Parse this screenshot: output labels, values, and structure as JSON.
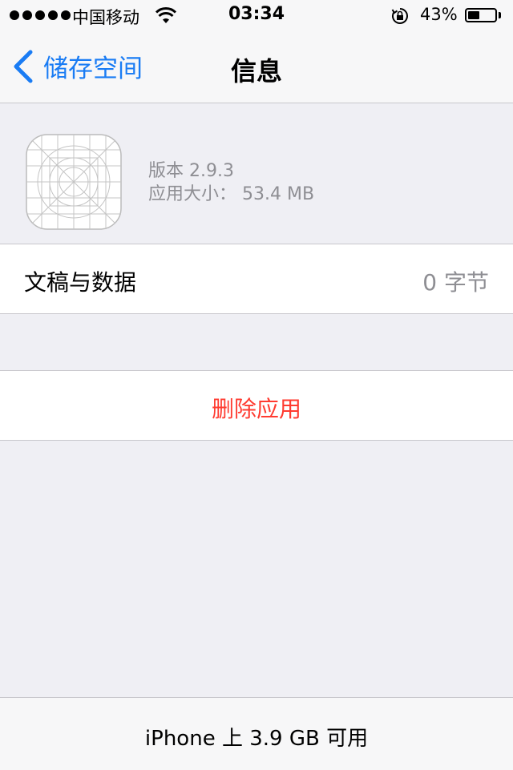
{
  "status_bar": {
    "carrier": "中国移动",
    "time": "03:34",
    "battery": "43%",
    "battery_level": 0.43,
    "icons": [
      "signal-icon",
      "wifi-icon",
      "rotation-lock-icon",
      "battery-icon"
    ]
  },
  "nav": {
    "back_label": "储存空间",
    "title": "信息",
    "accent_color": "#1a7cf4"
  },
  "app": {
    "version": "版本 2.9.3",
    "size": "应用大小： 53.4 MB"
  },
  "documents": {
    "label": "文稿与数据",
    "value": "0 字节"
  },
  "delete": {
    "label": "删除应用",
    "color": "#ff3b30"
  },
  "footer": {
    "text": "iPhone 上 3.9 GB 可用"
  }
}
